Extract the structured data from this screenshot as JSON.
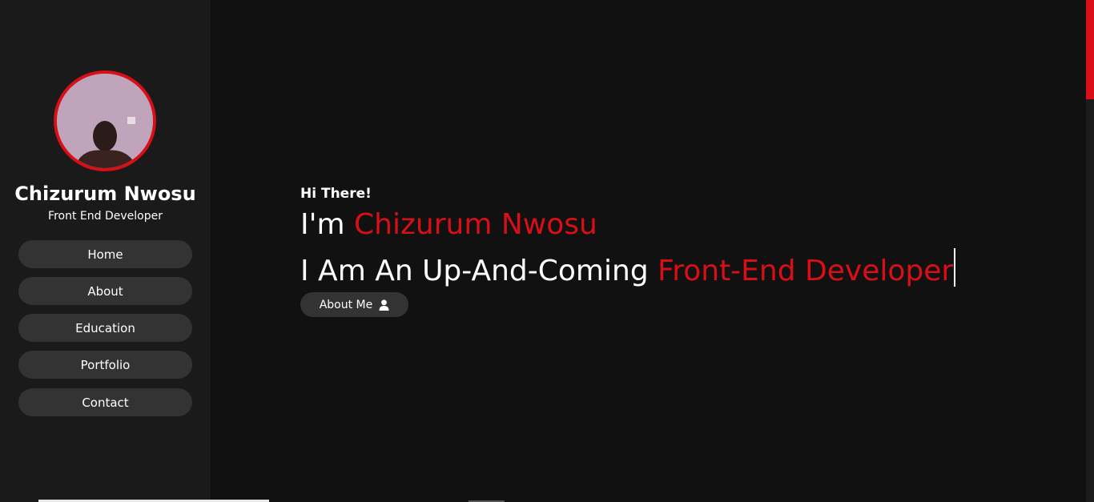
{
  "sidebar": {
    "name": "Chizurum Nwosu",
    "role": "Front End Developer",
    "nav": [
      {
        "label": "Home"
      },
      {
        "label": "About"
      },
      {
        "label": "Education"
      },
      {
        "label": "Portfolio"
      },
      {
        "label": "Contact"
      }
    ]
  },
  "hero": {
    "greeting": "Hi There!",
    "intro_prefix": "I'm ",
    "intro_name": "Chizurum Nwosu",
    "tagline_prefix": "I Am An Up-And-Coming ",
    "tagline_role": "Front-End Developer",
    "button_label": "About Me",
    "button_icon": "user-icon"
  },
  "colors": {
    "accent": "#d80f16",
    "background": "#111111",
    "sidebar": "#1a1a1a",
    "button": "#333333"
  }
}
